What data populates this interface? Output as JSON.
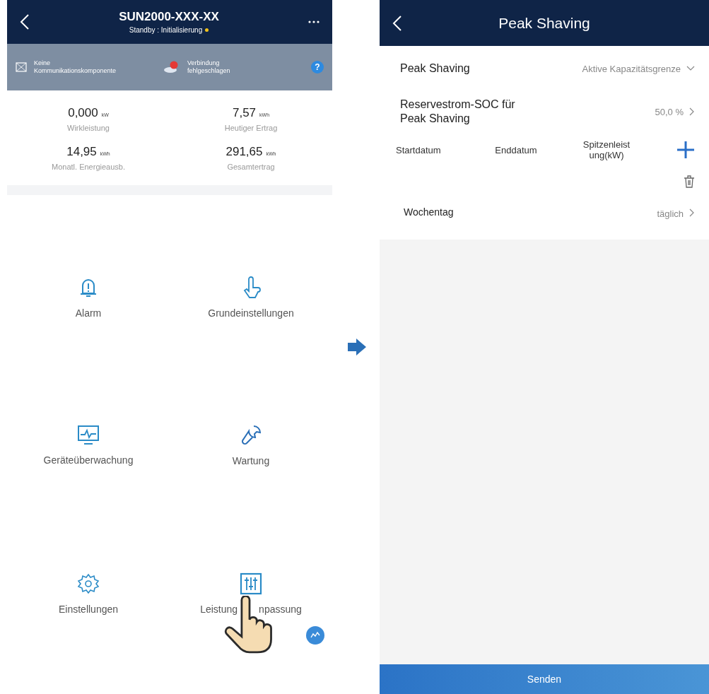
{
  "left_screen": {
    "title": "SUN2000-XXX-XX",
    "subtitle": "Standby : Initialisierung",
    "status_items": [
      {
        "kind": "comm",
        "text": "Keine Kommunikationskomponente"
      },
      {
        "kind": "cloud",
        "text": "Verbindung fehlgeschlagen"
      }
    ],
    "help": "?",
    "stats": [
      {
        "value": "0,000",
        "unit": "kW",
        "label": "Wirkleistung"
      },
      {
        "value": "7,57",
        "unit": "kWh",
        "label": "Heutiger Ertrag"
      },
      {
        "value": "14,95",
        "unit": "kWh",
        "label": "Monatl. Energieausb."
      },
      {
        "value": "291,65",
        "unit": "kWh",
        "label": "Gesamtertrag"
      }
    ],
    "menu": [
      {
        "label_parts": [
          "Alarm"
        ]
      },
      {
        "label_parts": [
          "Grundeinstellungen"
        ]
      },
      {
        "label_parts": [
          "Geräteüberwachung"
        ]
      },
      {
        "label_parts": [
          "Wartung"
        ]
      },
      {
        "label_parts": [
          "Einstellungen"
        ]
      },
      {
        "label_parts": [
          "Leistung",
          "npassung"
        ]
      }
    ]
  },
  "right_screen": {
    "title": "Peak Shaving",
    "mode": {
      "label": "Peak Shaving",
      "value": "Aktive Kapazitätsgrenze"
    },
    "reserve": {
      "label": "Reservestrom-SOC für Peak Shaving",
      "value": "50,0 %"
    },
    "columns": [
      "Startdatum",
      "Enddatum",
      "Spitzenleist ung(kW)"
    ],
    "weekday": {
      "label": "Wochentag",
      "value": "täglich"
    },
    "submit": "Senden"
  }
}
